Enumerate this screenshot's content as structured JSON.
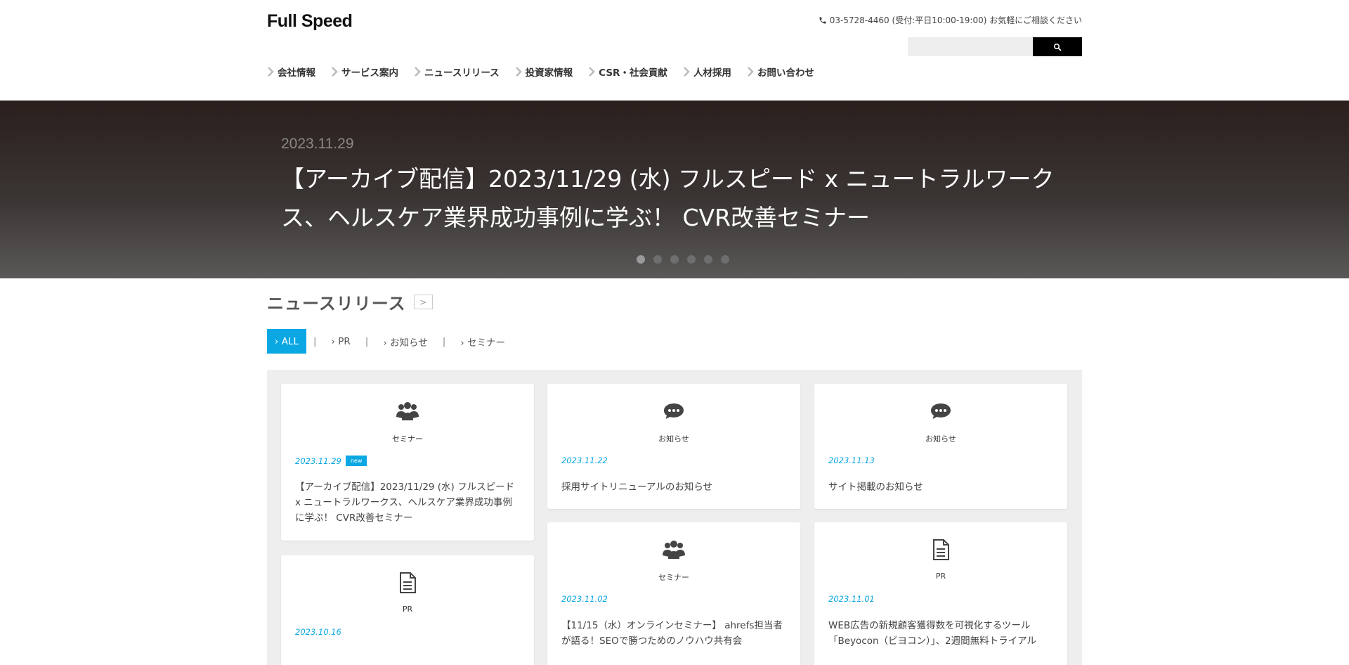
{
  "header": {
    "logo": "Full Speed",
    "contact": "03-5728-4460 (受付:平日10:00-19:00) お気軽にご相談ください",
    "search_placeholder": ""
  },
  "nav": [
    {
      "label": "会社情報"
    },
    {
      "label": "サービス案内"
    },
    {
      "label": "ニュースリリース"
    },
    {
      "label": "投資家情報"
    },
    {
      "label": "CSR・社会貢献"
    },
    {
      "label": "人材採用"
    },
    {
      "label": "お問い合わせ"
    }
  ],
  "hero": {
    "date": "2023.11.29",
    "title": "【アーカイブ配信】2023/11/29 (水) フルスピード x ニュートラルワークス、ヘルスケア業界成功事例に学ぶ！ CVR改善セミナー",
    "slide_count": 6,
    "active_slide": 1
  },
  "news": {
    "title": "ニュースリリース",
    "more_glyph": ">",
    "filters": [
      {
        "label": "› ALL",
        "active": true
      },
      {
        "label": "› PR",
        "active": false
      },
      {
        "label": "› お知らせ",
        "active": false
      },
      {
        "label": "› セミナー",
        "active": false
      }
    ],
    "separator": "|",
    "cards": [
      {
        "icon": "users-icon",
        "category": "セミナー",
        "date": "2023.11.29",
        "badge": "new",
        "title": "【アーカイブ配信】2023/11/29 (水) フルスピード x ニュートラルワークス、ヘルスケア業界成功事例に学ぶ！ CVR改善セミナー"
      },
      {
        "icon": "chat-icon",
        "category": "お知らせ",
        "date": "2023.11.22",
        "badge": "",
        "title": "採用サイトリニューアルのお知らせ"
      },
      {
        "icon": "chat-icon",
        "category": "お知らせ",
        "date": "2023.11.13",
        "badge": "",
        "title": "サイト掲載のお知らせ"
      },
      {
        "icon": "document-icon",
        "category": "PR",
        "date": "2023.10.16",
        "badge": "",
        "title": ""
      },
      {
        "icon": "users-icon",
        "category": "セミナー",
        "date": "2023.11.02",
        "badge": "",
        "title": "【11/15（水）オンラインセミナー】 ahrefs担当者が語る！SEOで勝つためのノウハウ共有会"
      },
      {
        "icon": "document-icon",
        "category": "PR",
        "date": "2023.11.01",
        "badge": "",
        "title": "WEB広告の新規顧客獲得数を可視化するツール「Beyocon（ビヨコン）」、2週間無料トライアル"
      }
    ]
  }
}
